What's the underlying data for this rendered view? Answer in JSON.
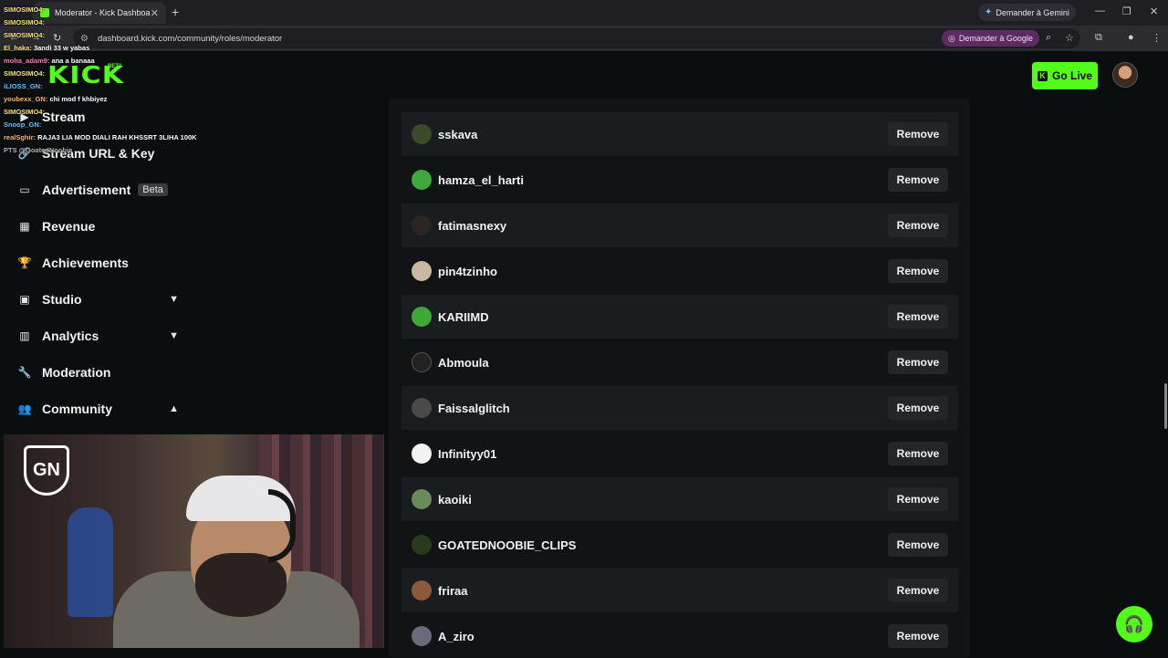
{
  "browser": {
    "tab_title": "Moderator - Kick Dashboard",
    "url": "dashboard.kick.com/community/roles/moderator",
    "gemini_label": "Demander à Gemini",
    "ask_google_label": "Demander à Google"
  },
  "header": {
    "logo": "KICK",
    "logo_tag": "BETA",
    "go_live_label": "Go Live"
  },
  "sidebar": {
    "items": [
      {
        "label": "Stream",
        "icon": "stream-icon"
      },
      {
        "label": "Stream URL & Key",
        "icon": "link-icon"
      },
      {
        "label": "Advertisement",
        "icon": "advertisement-icon",
        "badge": "Beta"
      },
      {
        "label": "Revenue",
        "icon": "revenue-icon"
      },
      {
        "label": "Achievements",
        "icon": "trophy-icon"
      },
      {
        "label": "Studio",
        "icon": "studio-icon",
        "chevron": "down"
      },
      {
        "label": "Analytics",
        "icon": "analytics-icon",
        "chevron": "down"
      },
      {
        "label": "Moderation",
        "icon": "wrench-icon"
      },
      {
        "label": "Community",
        "icon": "community-icon",
        "chevron": "up"
      }
    ]
  },
  "chat_overlay": [
    {
      "user": "SIMOSIMO4:",
      "msg": ""
    },
    {
      "user": "SIMOSIMO4:",
      "msg": ""
    },
    {
      "user": "SIMOSIMO4:",
      "msg": ""
    },
    {
      "user": "El_haka:",
      "msg": "3andi 33 w yabas"
    },
    {
      "user": "moha_adam9:",
      "msg": "ana a banaaa"
    },
    {
      "user": "SIMOSIMO4:",
      "msg": ""
    },
    {
      "user": "iLIOSS_GN:",
      "msg": ""
    },
    {
      "user": "youbexx_GN:",
      "msg": "chi mod f khbiyez"
    },
    {
      "user": "SIMOSIMO4:",
      "msg": ""
    },
    {
      "user": "Snoop_GN:",
      "msg": ""
    },
    {
      "user": "realSghir:",
      "msg": "RAJA3 LIA MOD DIALI RAH KHSSRT 3LIHA 100K"
    },
    {
      "user": "PTS @GoatedNoobie",
      "msg": ""
    }
  ],
  "moderators": [
    {
      "name": "sskava",
      "action": "Remove",
      "avatar_color": "#3a4a2a"
    },
    {
      "name": "hamza_el_harti",
      "action": "Remove",
      "avatar_color": "#3fa83a"
    },
    {
      "name": "fatimasnexy",
      "action": "Remove",
      "avatar_color": "#2a2422"
    },
    {
      "name": "pin4tzinho",
      "action": "Remove",
      "avatar_color": "#c9b9a2"
    },
    {
      "name": "KARIIMD",
      "action": "Remove",
      "avatar_color": "#3fa83a"
    },
    {
      "name": "Abmoula",
      "action": "Remove",
      "avatar_color": "#222222"
    },
    {
      "name": "Faissalglitch",
      "action": "Remove",
      "avatar_color": "#4a4a4a"
    },
    {
      "name": "Infinityy01",
      "action": "Remove",
      "avatar_color": "#f2f2f2"
    },
    {
      "name": "kaoiki",
      "action": "Remove",
      "avatar_color": "#6a8a5a"
    },
    {
      "name": "GOATEDNOOBIE_CLIPS",
      "action": "Remove",
      "avatar_color": "#2a3a1a"
    },
    {
      "name": "friraa",
      "action": "Remove",
      "avatar_color": "#8a5a3a"
    },
    {
      "name": "A_ziro",
      "action": "Remove",
      "avatar_color": "#6a6a7a"
    }
  ],
  "colors": {
    "accent": "#53fc18",
    "background": "#0b0e0f",
    "row_alt": "#1a1d1f"
  }
}
